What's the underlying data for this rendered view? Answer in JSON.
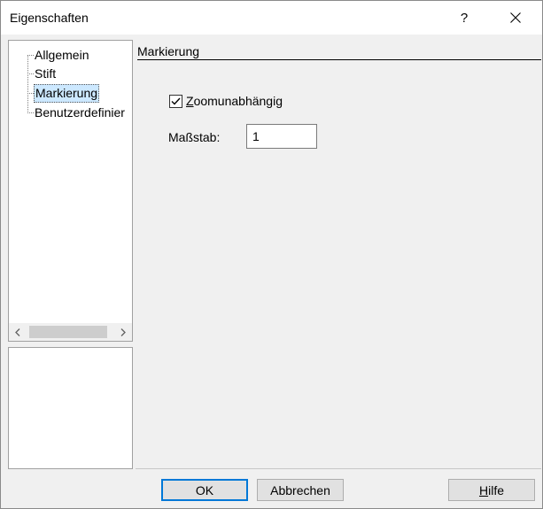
{
  "window": {
    "title": "Eigenschaften",
    "help_label": "?"
  },
  "tree": {
    "items": [
      {
        "label": "Allgemein",
        "selected": false
      },
      {
        "label": "Stift",
        "selected": false
      },
      {
        "label": "Markierung",
        "selected": true
      },
      {
        "label": "Benutzerdefinier",
        "selected": false
      }
    ],
    "scroll_left": "<",
    "scroll_right": ">"
  },
  "panel": {
    "heading": "Markierung",
    "zoom_checkbox": {
      "mnemonic": "Z",
      "label_rest": "oomunabhängig",
      "checked": true
    },
    "scale": {
      "label": "Maßstab:",
      "value": "1"
    }
  },
  "buttons": {
    "ok": "OK",
    "cancel": "Abbrechen",
    "help_mnemonic": "H",
    "help_rest": "ilfe"
  },
  "colors": {
    "selection": "#cce8ff",
    "default_button_border": "#0078d7",
    "dialog_bg": "#f0f0f0"
  },
  "icons": [
    "close-icon",
    "checkmark-icon",
    "chevron-left-icon",
    "chevron-right-icon"
  ]
}
